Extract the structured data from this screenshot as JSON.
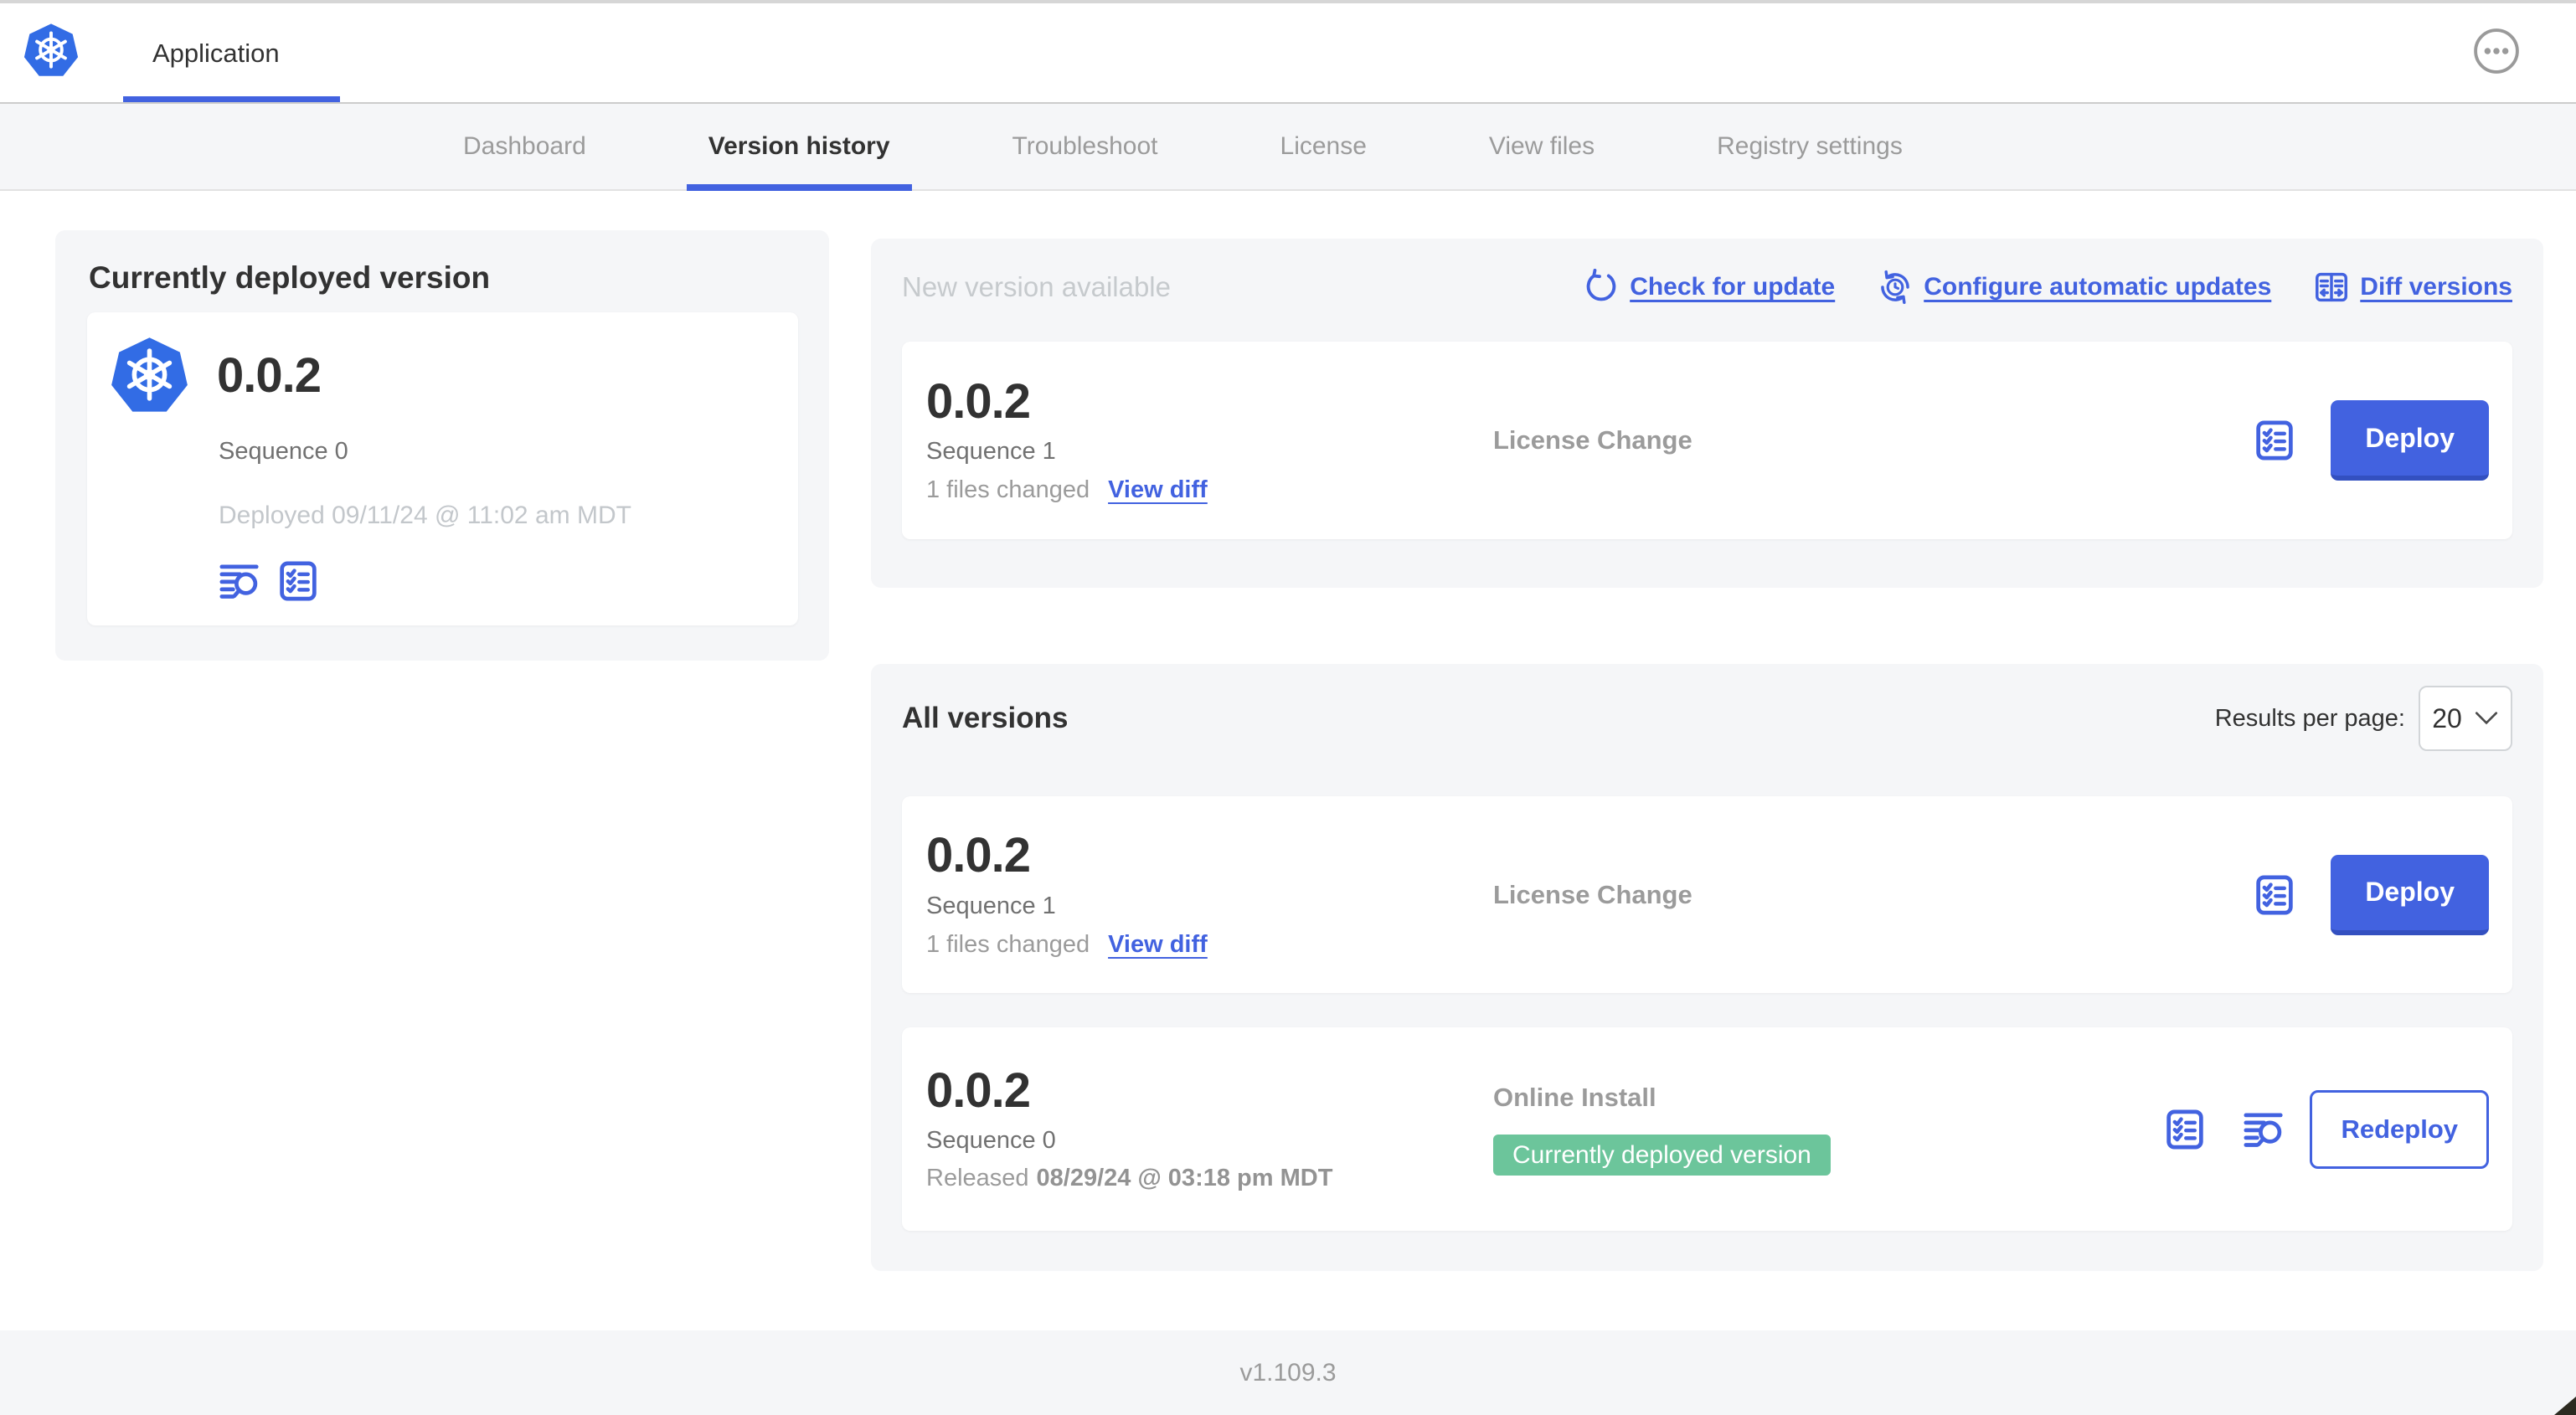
{
  "colors": {
    "accent_blue": "#4262e0",
    "k8s_logo_blue": "#326ce5",
    "badge_green": "#6cc59b",
    "panel_background": "#f5f6f8",
    "muted_text": "#9b9b9b",
    "faint_text": "#c3c7cb"
  },
  "header": {
    "app_title": "Application"
  },
  "nav": {
    "tabs": [
      {
        "label": "Dashboard",
        "active": false
      },
      {
        "label": "Version history",
        "active": true
      },
      {
        "label": "Troubleshoot",
        "active": false
      },
      {
        "label": "License",
        "active": false
      },
      {
        "label": "View files",
        "active": false
      },
      {
        "label": "Registry settings",
        "active": false
      }
    ]
  },
  "current_version_panel": {
    "title": "Currently deployed version",
    "version": "0.0.2",
    "sequence": "Sequence 0",
    "deployed": "Deployed 09/11/24 @ 11:02 am MDT",
    "icons": [
      "logs-icon",
      "checklist-icon"
    ]
  },
  "new_version_panel": {
    "title": "New version available",
    "links": [
      {
        "label": "Check for update",
        "icon": "refresh-icon"
      },
      {
        "label": "Configure automatic updates",
        "icon": "auto-update-icon"
      },
      {
        "label": "Diff versions",
        "icon": "diff-icon"
      }
    ],
    "row": {
      "version": "0.0.2",
      "sequence": "Sequence 1",
      "files_changed": "1 files changed",
      "view_diff_label": "View diff",
      "release_title": "License Change",
      "deploy_label": "Deploy"
    }
  },
  "all_versions_panel": {
    "title": "All versions",
    "results_per_page_label": "Results per page:",
    "results_per_page_value": "20",
    "rows": [
      {
        "version": "0.0.2",
        "sequence": "Sequence 1",
        "files_changed": "1 files changed",
        "view_diff_label": "View diff",
        "release_title": "License Change",
        "action_label": "Deploy"
      },
      {
        "version": "0.0.2",
        "sequence": "Sequence 0",
        "released_prefix": "Released",
        "released_date": "08/29/24 @ 03:18 pm MDT",
        "install_type": "Online Install",
        "badge_label": "Currently deployed version",
        "action_label": "Redeploy"
      }
    ]
  },
  "footer": {
    "app_manager_version": "v1.109.3"
  }
}
